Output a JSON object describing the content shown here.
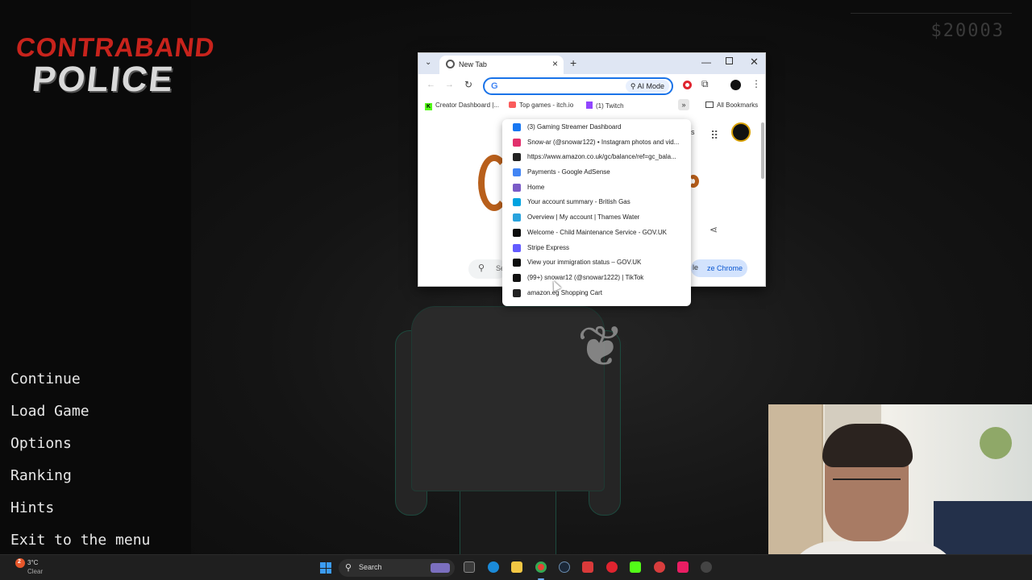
{
  "game": {
    "logo_line1": "CONTRABAND",
    "logo_line2": "POLICE",
    "money": "$20003",
    "menu": [
      "Continue",
      "Load Game",
      "Options",
      "Ranking",
      "Hints",
      "Exit to the menu"
    ]
  },
  "browser": {
    "tab_title": "New Tab",
    "omnibox": {
      "value": "",
      "ai_mode_label": "AI Mode"
    },
    "bookmarks": [
      {
        "label": "Creator Dashboard |...",
        "icon": "kick-icon"
      },
      {
        "label": "Top games - itch.io",
        "icon": "itch-icon"
      },
      {
        "label": "(1) Twitch",
        "icon": "twitch-icon"
      }
    ],
    "all_bookmarks_label": "All Bookmarks",
    "ntp": {
      "search_text": "Se",
      "customize_label": "ze Chrome",
      "partial_le": "le",
      "partial_es": "es"
    }
  },
  "dropdown": {
    "items": [
      {
        "label": "(3) Gaming Streamer Dashboard",
        "icon": "meta-icon",
        "color": "#1877f2"
      },
      {
        "label": "Snow-ar (@snowar122) • Instagram photos and vid...",
        "icon": "instagram-icon",
        "color": "#e1306c"
      },
      {
        "label": "https://www.amazon.co.uk/gc/balance/ref=gc_bala...",
        "icon": "amazon-icon",
        "color": "#222222"
      },
      {
        "label": "Payments - Google AdSense",
        "icon": "google-icon",
        "color": "#4285f4"
      },
      {
        "label": "Home",
        "icon": "home-site-icon",
        "color": "#7a5bc7"
      },
      {
        "label": "Your account summary - British Gas",
        "icon": "britishgas-icon",
        "color": "#00a3e0"
      },
      {
        "label": "Overview | My account | Thames Water",
        "icon": "thames-icon",
        "color": "#29a3dd"
      },
      {
        "label": "Welcome - Child Maintenance Service - GOV.UK",
        "icon": "govuk-icon",
        "color": "#0b0c0c"
      },
      {
        "label": "Stripe Express",
        "icon": "stripe-icon",
        "color": "#635bff"
      },
      {
        "label": "View your immigration status – GOV.UK",
        "icon": "govuk-icon",
        "color": "#0b0c0c"
      },
      {
        "label": "(99+) snowar12 (@snowar1222) | TikTok",
        "icon": "tiktok-icon",
        "color": "#111111"
      },
      {
        "label": "amazon.eg Shopping Cart",
        "icon": "amazon-icon",
        "color": "#222222"
      }
    ]
  },
  "taskbar": {
    "weather_badge": "2",
    "weather_temp": "3°C",
    "weather_desc": "Clear",
    "search_label": "Search"
  }
}
